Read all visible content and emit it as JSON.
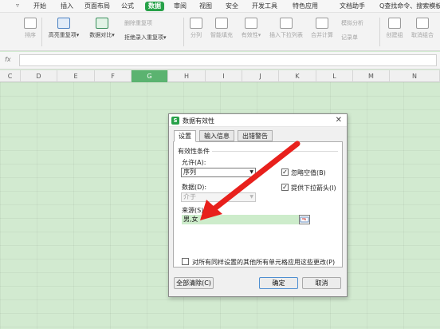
{
  "menubar": {
    "icon": "menu-lines-icon",
    "items": [
      "开始",
      "插入",
      "页面布局",
      "公式",
      "数据",
      "审阅",
      "视图",
      "安全",
      "开发工具",
      "特色应用",
      "文档助手"
    ],
    "active_index": 4,
    "search": "Q查找命令、搜索模板"
  },
  "ribbon": {
    "items": [
      {
        "label": "排序",
        "icon": "sort-icon",
        "dim": true
      },
      {
        "label": "高亮重复项▾",
        "icon": "highlight-duplicates-icon",
        "dim": false
      },
      {
        "label": "数据对比▾",
        "icon": "data-compare-icon",
        "dim": false
      },
      {
        "label": "分列",
        "icon": "split-column-icon",
        "dim": true
      },
      {
        "label": "智能填充",
        "icon": "smart-fill-icon",
        "dim": true
      },
      {
        "label": "有效性▾",
        "icon": "validation-icon",
        "dim": true
      },
      {
        "label": "插入下拉列表",
        "icon": "dropdown-list-icon",
        "dim": true
      },
      {
        "label": "合并计算",
        "icon": "consolidate-icon",
        "dim": true
      },
      {
        "label": "创建组",
        "icon": "group-icon",
        "dim": true
      },
      {
        "label": "取消组合",
        "icon": "ungroup-icon",
        "dim": true
      }
    ],
    "small_items": [
      {
        "label": "删除重复项",
        "dim": true
      },
      {
        "label": "拒绝录入重复项▾",
        "dim": false
      },
      {
        "label": "模拟分析",
        "dim": true
      },
      {
        "label": "记录单",
        "dim": true
      }
    ]
  },
  "formula_bar": {
    "fx": "fx",
    "value": ""
  },
  "columns": [
    "C",
    "D",
    "E",
    "F",
    "G",
    "H",
    "I",
    "J",
    "K",
    "L",
    "M",
    "N"
  ],
  "selected_column": "G",
  "dialog": {
    "title": "数据有效性",
    "tabs": [
      "设置",
      "输入信息",
      "出错警告"
    ],
    "active_tab": 0,
    "condition_label": "有效性条件",
    "allow_label": "允许(A):",
    "allow_value": "序列",
    "ignore_blank_label": "忽略空值(B)",
    "ignore_blank_checked": true,
    "provide_dropdown_label": "提供下拉箭头(I)",
    "provide_dropdown_checked": true,
    "data_label": "数据(D):",
    "data_value": "介于",
    "source_label": "来源(S):",
    "source_value": "男,女",
    "apply_all_label": "对所有同样设置的其他所有单元格应用这些更改(P)",
    "apply_all_checked": false,
    "clear_all_button": "全部清除(C)",
    "ok_button": "确定",
    "cancel_button": "取消",
    "close_glyph": "✕",
    "logo_glyph": "S"
  },
  "colors": {
    "accent": "#27a149",
    "sheet_bg": "#d2ead0",
    "annotation_arrow": "#e8201c"
  }
}
